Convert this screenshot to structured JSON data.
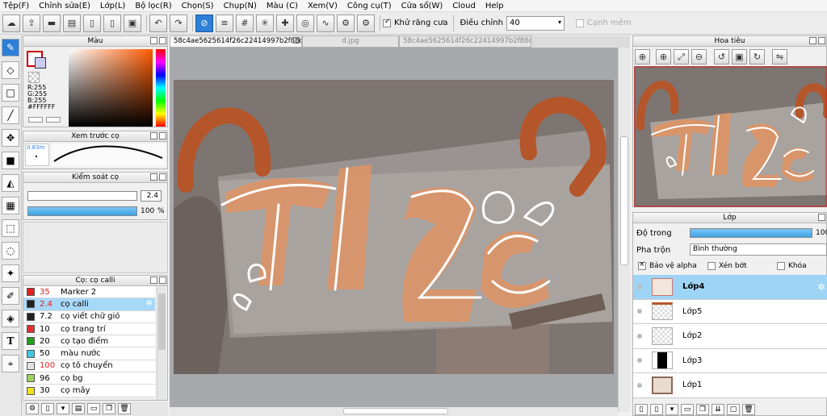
{
  "menu": [
    "Tệp(F)",
    "Chỉnh sửa(E)",
    "Lớp(L)",
    "Bộ lọc(R)",
    "Chọn(S)",
    "Chụp(N)",
    "Màu (C)",
    "Xem(V)",
    "Công cụ(T)",
    "Cửa sổ(W)",
    "Cloud",
    "Help"
  ],
  "toolbar": {
    "antialias_label": "Khử răng cưa",
    "adjust_label": "Điều chỉnh",
    "adjust_value": "40",
    "smooth_label": "Cạnh mềm"
  },
  "color_panel": {
    "title": "Màu",
    "r": "R:255",
    "g": "G:255",
    "b": "B:255",
    "hex": "#FFFFFF"
  },
  "brush_preview": {
    "title": "Xem trước cọ",
    "size": "0.83m"
  },
  "brush_control": {
    "title": "Kiểm soát cọ",
    "size_value": "2.4",
    "size_fraction": 0.95,
    "opacity_value": "100",
    "opacity_unit": "%",
    "opacity_fraction": 1.0
  },
  "brush_list": {
    "title": "Cọ: cọ calli",
    "items": [
      {
        "color": "#e02020",
        "size": "35",
        "name": "Marker 2",
        "size_color": "#e02020"
      },
      {
        "color": "#222222",
        "size": "2.4",
        "name": "cọ calli",
        "size_color": "#e02020",
        "selected": true
      },
      {
        "color": "#222222",
        "size": "7.2",
        "name": "cọ viết chữ gió",
        "size_color": "#000000"
      },
      {
        "color": "#e03030",
        "size": "10",
        "name": "cọ trang trí",
        "size_color": "#000000"
      },
      {
        "color": "#20a020",
        "size": "20",
        "name": "cọ tạo điểm",
        "size_color": "#000000"
      },
      {
        "color": "#40c8e0",
        "size": "50",
        "name": "màu nước",
        "size_color": "#000000"
      },
      {
        "color": "#e0e0e0",
        "size": "100",
        "name": "cọ tô chuyển",
        "size_color": "#e02020"
      },
      {
        "color": "#a0d060",
        "size": "96",
        "name": "cọ bg",
        "size_color": "#000000"
      },
      {
        "color": "#f0e020",
        "size": "30",
        "name": "cọ mây",
        "size_color": "#000000"
      }
    ]
  },
  "tabs": [
    "58c4ae5625614f26c22414997b2f88c7.jpg",
    "d.jpg",
    "58c4ae5625614f26c22414997b2f88c7.jpg"
  ],
  "navigator": {
    "title": "Hoa tiêu"
  },
  "layers": {
    "title": "Lớp",
    "opacity_label": "Độ trong",
    "opacity_value": "100",
    "opacity_fraction": 1.0,
    "blend_label": "Pha trộn",
    "blend_value": "Bình thường",
    "protect_alpha": "Bảo vệ alpha",
    "clipping": "Xén bớt",
    "lock": "Khóa",
    "items": [
      {
        "name": "Lớp4",
        "selected": true
      },
      {
        "name": "Lớp5"
      },
      {
        "name": "Lớp2"
      },
      {
        "name": "Lớp3"
      },
      {
        "name": "Lớp1"
      }
    ]
  },
  "artwork_text": "tiệc",
  "colors": {
    "accent": "#2d7fd8",
    "selection": "#a8d8f8",
    "layer_selection": "#9ed4f5",
    "orange_ribbon": "#b5552a",
    "letter_fill": "#d9956a"
  }
}
